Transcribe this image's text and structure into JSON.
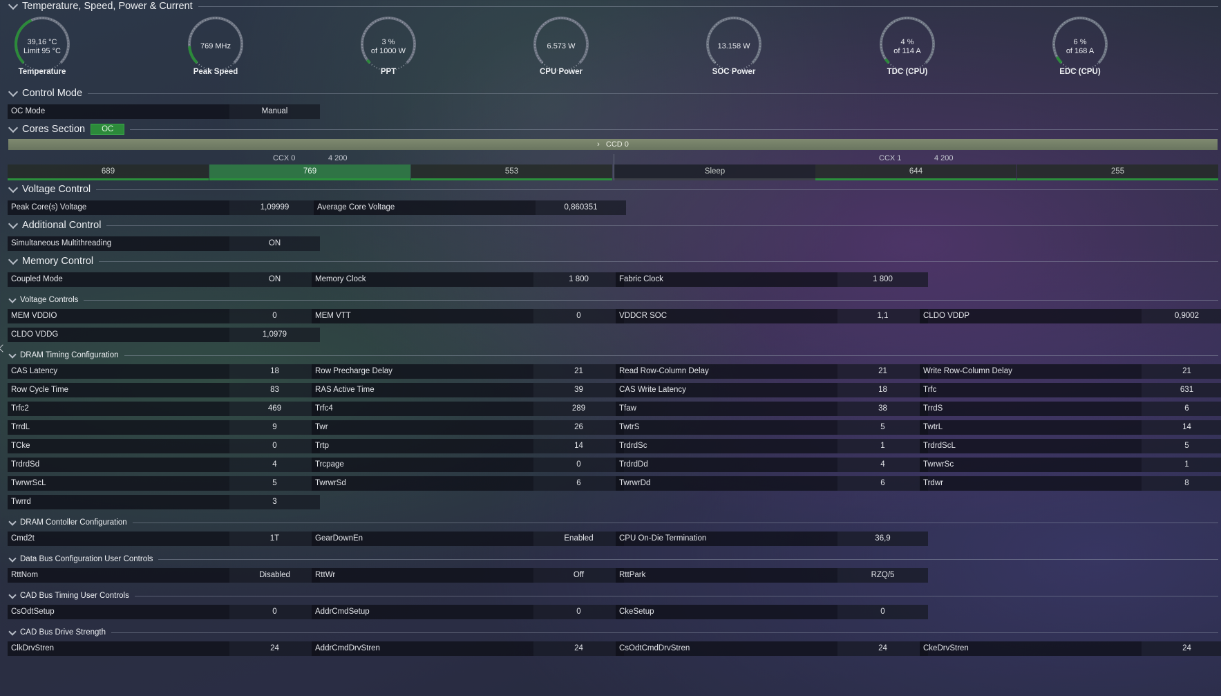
{
  "sections": {
    "temp": "Temperature, Speed, Power & Current",
    "control_mode": "Control Mode",
    "cores": "Cores Section",
    "voltage_control": "Voltage Control",
    "additional_control": "Additional Control",
    "memory_control": "Memory Control",
    "voltage_controls": "Voltage Controls",
    "dram_timing": "DRAM Timing Configuration",
    "dram_controller": "DRAM Contoller Configuration",
    "data_bus": "Data Bus Configuration User Controls",
    "cad_timing": "CAD Bus Timing User Controls",
    "cad_drive": "CAD Bus Drive Strength"
  },
  "cores_badge": "OC",
  "gauges": [
    {
      "line1": "39,16 °C",
      "line2": "Limit 95 °C",
      "label": "Temperature",
      "fraction": 0.41
    },
    {
      "line1": "769  MHz",
      "line2": "",
      "label": "Peak Speed",
      "fraction": 0.15
    },
    {
      "line1": "3 %",
      "line2": "of 1000 W",
      "label": "PPT",
      "fraction": 0.03
    },
    {
      "line1": "6.573 W",
      "line2": "",
      "label": "CPU Power",
      "fraction": 0.0
    },
    {
      "line1": "13.158 W",
      "line2": "",
      "label": "SOC Power",
      "fraction": 0.0
    },
    {
      "line1": "4 %",
      "line2": "of 114 A",
      "label": "TDC (CPU)",
      "fraction": 0.04
    },
    {
      "line1": "6 %",
      "line2": "of 168 A",
      "label": "EDC (CPU)",
      "fraction": 0.06
    }
  ],
  "control_mode": {
    "oc_mode": {
      "label": "OC Mode",
      "value": "Manual"
    }
  },
  "ccd": {
    "label": "CCD 0",
    "ccx": [
      {
        "label": "CCX 0",
        "freq": "4 200",
        "cores": [
          "689",
          "769",
          "553"
        ]
      },
      {
        "label": "CCX 1",
        "freq": "4 200",
        "cores": [
          "Sleep",
          "644",
          "255"
        ]
      }
    ]
  },
  "voltage": {
    "peak": {
      "label": "Peak Core(s) Voltage",
      "value": "1,09999"
    },
    "average": {
      "label": "Average Core Voltage",
      "value": "0,860351"
    }
  },
  "additional": {
    "smt": {
      "label": "Simultaneous Multithreading",
      "value": "ON"
    }
  },
  "memory": {
    "coupled": {
      "label": "Coupled Mode",
      "value": "ON"
    },
    "mem_clock": {
      "label": "Memory Clock",
      "value": "1 800"
    },
    "fabric_clock": {
      "label": "Fabric Clock",
      "value": "1 800"
    }
  },
  "voltage_controls": [
    {
      "label": "MEM VDDIO",
      "value": "0"
    },
    {
      "label": "MEM VTT",
      "value": "0"
    },
    {
      "label": "VDDCR SOC",
      "value": "1,1"
    },
    {
      "label": "CLDO VDDP",
      "value": "0,9002"
    },
    {
      "label": "CLDO VDDG",
      "value": "1,0979"
    }
  ],
  "dram_timing": [
    {
      "label": "CAS Latency",
      "value": "18"
    },
    {
      "label": "Row Precharge Delay",
      "value": "21"
    },
    {
      "label": "Read Row-Column Delay",
      "value": "21"
    },
    {
      "label": "Write Row-Column Delay",
      "value": "21"
    },
    {
      "label": "Row Cycle Time",
      "value": "83"
    },
    {
      "label": "RAS Active Time",
      "value": "39"
    },
    {
      "label": "CAS Write Latency",
      "value": "18"
    },
    {
      "label": "Trfc",
      "value": "631"
    },
    {
      "label": "Trfc2",
      "value": "469"
    },
    {
      "label": "Trfc4",
      "value": "289"
    },
    {
      "label": "Tfaw",
      "value": "38"
    },
    {
      "label": "TrrdS",
      "value": "6"
    },
    {
      "label": "TrrdL",
      "value": "9"
    },
    {
      "label": "Twr",
      "value": "26"
    },
    {
      "label": "TwtrS",
      "value": "5"
    },
    {
      "label": "TwtrL",
      "value": "14"
    },
    {
      "label": "TCke",
      "value": "0"
    },
    {
      "label": "Trtp",
      "value": "14"
    },
    {
      "label": "TrdrdSc",
      "value": "1"
    },
    {
      "label": "TrdrdScL",
      "value": "5"
    },
    {
      "label": "TrdrdSd",
      "value": "4"
    },
    {
      "label": "Trcpage",
      "value": "0"
    },
    {
      "label": "TrdrdDd",
      "value": "4"
    },
    {
      "label": "TwrwrSc",
      "value": "1"
    },
    {
      "label": "TwrwrScL",
      "value": "5"
    },
    {
      "label": "TwrwrSd",
      "value": "6"
    },
    {
      "label": "TwrwrDd",
      "value": "6"
    },
    {
      "label": "Trdwr",
      "value": "8"
    },
    {
      "label": "Twrrd",
      "value": "3"
    }
  ],
  "dram_controller": [
    {
      "label": "Cmd2t",
      "value": "1T"
    },
    {
      "label": "GearDownEn",
      "value": "Enabled"
    },
    {
      "label": "CPU On-Die Termination",
      "value": "36,9"
    }
  ],
  "data_bus": [
    {
      "label": "RttNom",
      "value": "Disabled"
    },
    {
      "label": "RttWr",
      "value": "Off"
    },
    {
      "label": "RttPark",
      "value": "RZQ/5"
    }
  ],
  "cad_timing": [
    {
      "label": "CsOdtSetup",
      "value": "0"
    },
    {
      "label": "AddrCmdSetup",
      "value": "0"
    },
    {
      "label": "CkeSetup",
      "value": "0"
    }
  ],
  "cad_drive": [
    {
      "label": "ClkDrvStren",
      "value": "24"
    },
    {
      "label": "AddrCmdDrvStren",
      "value": "24"
    },
    {
      "label": "CsOdtCmdDrvStren",
      "value": "24"
    },
    {
      "label": "CkeDrvStren",
      "value": "24"
    }
  ],
  "colors": {
    "accent_green": "#2c8a3a",
    "gauge_track": "#6b7280",
    "core_active": "#2f7445"
  }
}
